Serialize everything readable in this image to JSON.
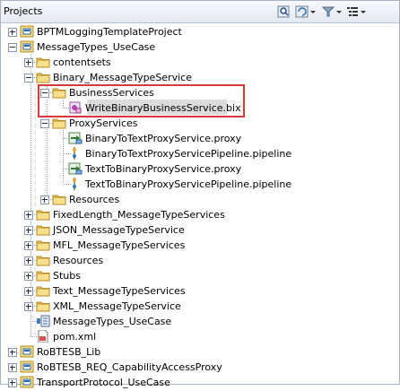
{
  "panel": {
    "title": "Projects"
  },
  "toolbar": {
    "icons": [
      "search-icon",
      "refresh-dropdown-icon",
      "filter-icon",
      "view-menu-icon"
    ]
  },
  "tree": {
    "items": [
      {
        "label": "BPTMLoggingTemplateProject",
        "type": "project",
        "expanded": false
      },
      {
        "label": "MessageTypes_UseCase",
        "type": "project",
        "expanded": true
      },
      {
        "label": "contentsets",
        "type": "folder",
        "expanded": false
      },
      {
        "label": "Binary_MessageTypeService",
        "type": "folder",
        "expanded": true
      },
      {
        "label": "BusinessServices",
        "type": "folder",
        "expanded": true
      },
      {
        "label": "WriteBinaryBusinessService.bix",
        "type": "business-service",
        "selected": true
      },
      {
        "label": "ProxyServices",
        "type": "folder",
        "expanded": true
      },
      {
        "label": "BinaryToTextProxyService.proxy",
        "type": "proxy-service"
      },
      {
        "label": "BinaryToTextProxyServicePipeline.pipeline",
        "type": "pipeline"
      },
      {
        "label": "TextToBinaryProxyService.proxy",
        "type": "proxy-service"
      },
      {
        "label": "TextToBinaryProxyServicePipeline.pipeline",
        "type": "pipeline"
      },
      {
        "label": "Resources",
        "type": "folder",
        "expanded": false
      },
      {
        "label": "FixedLength_MessageTypeServices",
        "type": "folder",
        "expanded": false
      },
      {
        "label": "JSON_MessageTypeService",
        "type": "folder",
        "expanded": false
      },
      {
        "label": "MFL_MessageTypeServices",
        "type": "folder",
        "expanded": false
      },
      {
        "label": "Resources",
        "type": "folder",
        "expanded": false
      },
      {
        "label": "Stubs",
        "type": "folder",
        "expanded": false
      },
      {
        "label": "Text_MessageTypeServices",
        "type": "folder",
        "expanded": false
      },
      {
        "label": "XML_MessageTypeService",
        "type": "folder",
        "expanded": false
      },
      {
        "label": "MessageTypes_UseCase",
        "type": "composite"
      },
      {
        "label": "pom.xml",
        "type": "xml-file"
      },
      {
        "label": "RoBTESB_Lib",
        "type": "project",
        "expanded": false
      },
      {
        "label": "RoBTESB_REQ_CapabilityAccessProxy",
        "type": "project",
        "expanded": false
      },
      {
        "label": "TransportProtocol_UseCase",
        "type": "project",
        "expanded": false
      }
    ]
  }
}
